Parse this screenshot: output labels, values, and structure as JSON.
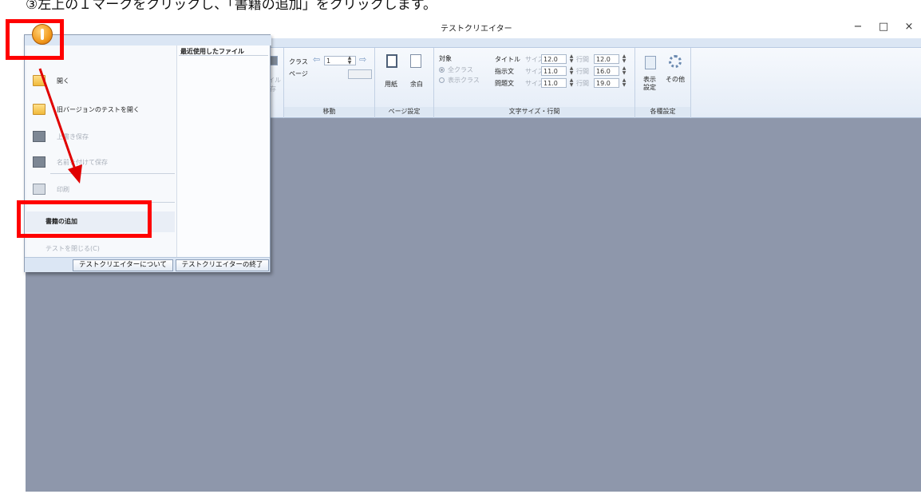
{
  "instruction": "③左上のＩマークをクリックし、「書籍の追加」をクリックします。",
  "window": {
    "title": "テストクリエイター",
    "controls": {
      "minimize": "−",
      "maximize": "□",
      "close": "×"
    }
  },
  "ribbon": {
    "groups": {
      "file": {
        "frag1": "イル",
        "frag2": "存"
      },
      "move": {
        "label": "移動",
        "class": "クラス",
        "page": "ページ",
        "class_value": "1"
      },
      "page_setup": {
        "label": "ページ設定",
        "paper": "用紙",
        "margin": "余白"
      },
      "target": {
        "title": "対象",
        "all_classes": "全クラス",
        "shown_class": "表示クラス"
      },
      "text_size": {
        "label": "文字サイズ・行間",
        "rows": [
          {
            "name": "タイトル",
            "size_label": "サイズ",
            "size": "12.0",
            "spacing_label": "行間",
            "spacing": "12.0"
          },
          {
            "name": "指示文",
            "size_label": "サイズ",
            "size": "11.0",
            "spacing_label": "行間",
            "spacing": "16.0"
          },
          {
            "name": "問題文",
            "size_label": "サイズ",
            "size": "11.0",
            "spacing_label": "行間",
            "spacing": "19.0"
          }
        ]
      },
      "settings": {
        "label": "各種設定",
        "display": "表示",
        "display2": "設定",
        "other": "その他"
      }
    }
  },
  "app_menu": {
    "recent_files_title": "最近使用したファイル",
    "items": [
      {
        "label": "開く",
        "icon": "folder-icon",
        "disabled": false
      },
      {
        "label": "旧バージョンのテストを開く",
        "icon": "folder-open-icon",
        "disabled": false
      },
      {
        "label": "上書き保存",
        "icon": "floppy-icon",
        "disabled": true
      },
      {
        "label": "名前を付けて保存",
        "icon": "floppy-save-as-icon",
        "disabled": true
      },
      {
        "label": "印刷",
        "icon": "printer-icon",
        "disabled": true
      },
      {
        "label": "書籍の追加",
        "icon": "",
        "disabled": false
      },
      {
        "label": "テストを閉じる(C)",
        "icon": "",
        "disabled": true
      }
    ],
    "footer": {
      "about": "テストクリエイターについて",
      "exit": "テストクリエイターの終了"
    }
  },
  "annotation_color": "#ff0000"
}
